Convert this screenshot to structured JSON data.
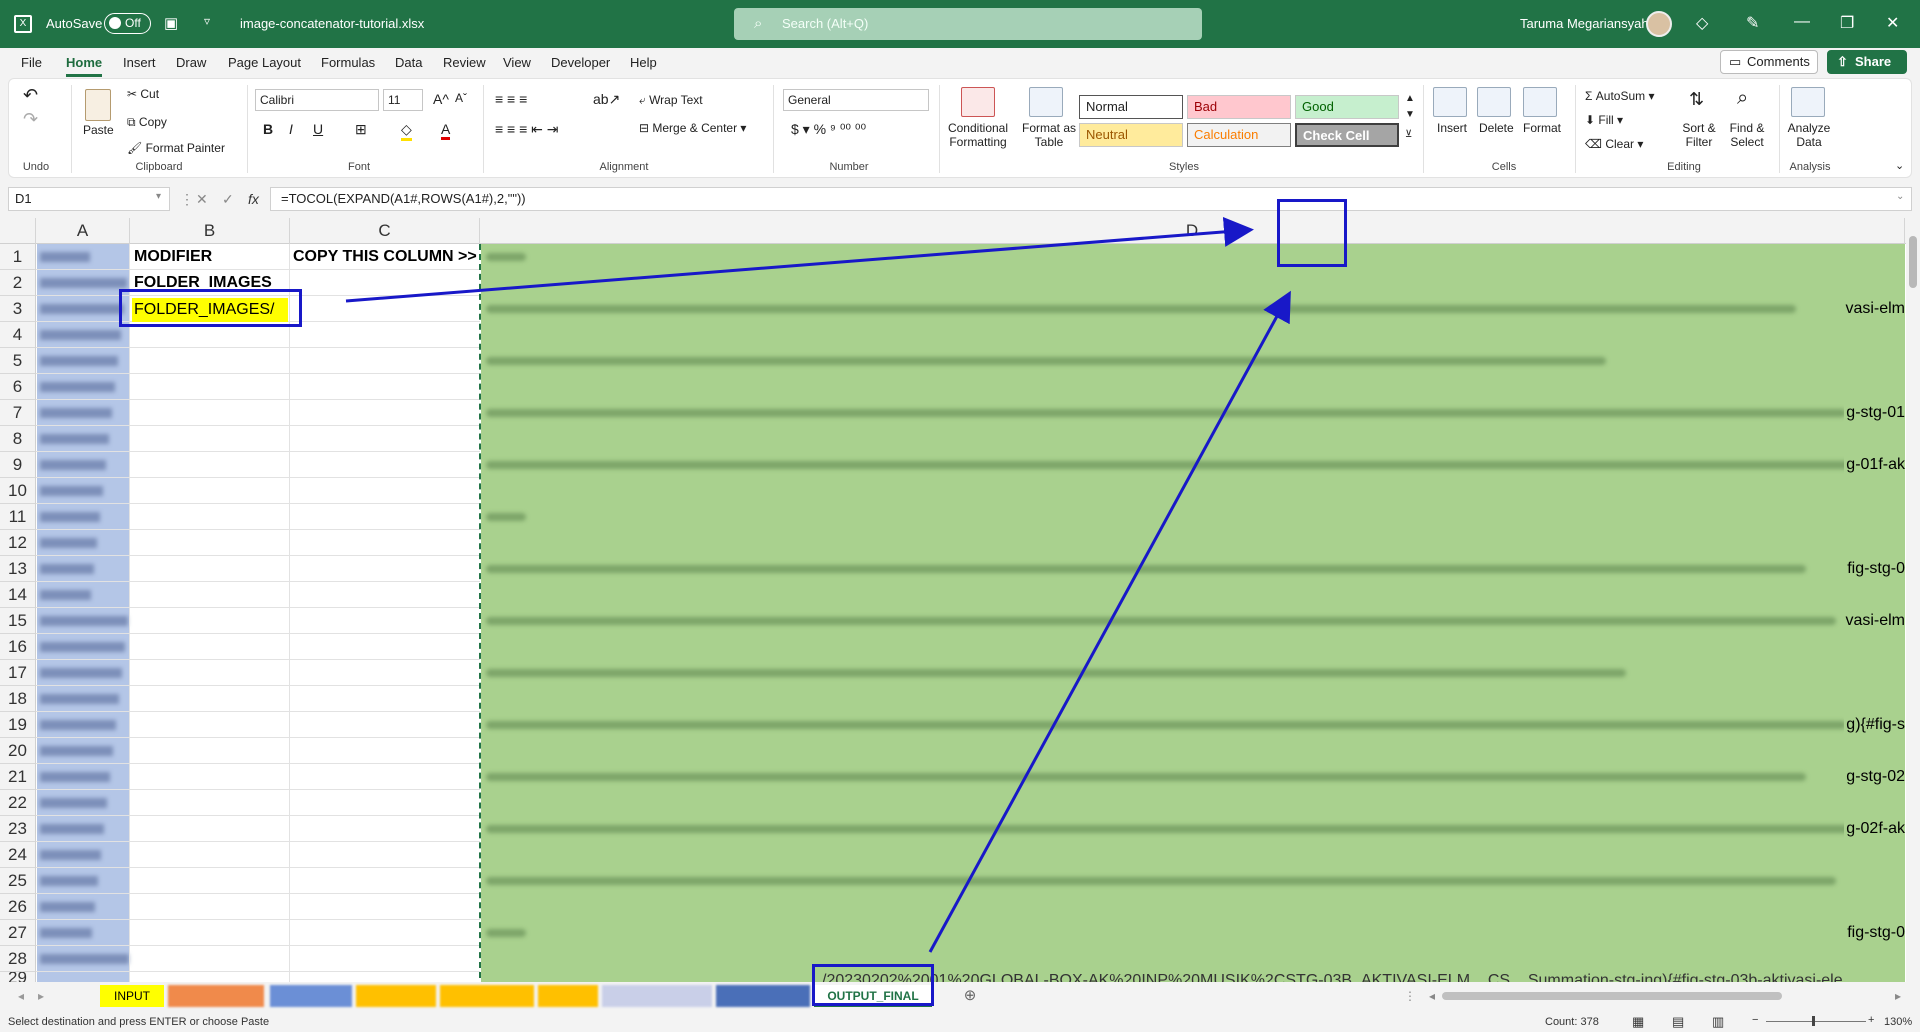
{
  "title_bar": {
    "autosave_label": "AutoSave",
    "autosave_state": "Off",
    "file_name": "image-concatenator-tutorial.xlsx",
    "search_placeholder": "Search (Alt+Q)",
    "user_name": "Taruma Megariansyah"
  },
  "menu": [
    "File",
    "Home",
    "Insert",
    "Draw",
    "Page Layout",
    "Formulas",
    "Data",
    "Review",
    "View",
    "Developer",
    "Help"
  ],
  "menu_active": "Home",
  "top_buttons": {
    "comments": "Comments",
    "share": "Share"
  },
  "ribbon": {
    "undo_group": "Undo",
    "clipboard": {
      "paste": "Paste",
      "cut": "Cut",
      "copy": "Copy",
      "format_painter": "Format Painter",
      "group": "Clipboard"
    },
    "font": {
      "name": "Calibri",
      "size": "11",
      "group": "Font"
    },
    "alignment": {
      "wrap": "Wrap Text",
      "merge": "Merge & Center",
      "group": "Alignment"
    },
    "number": {
      "format": "General",
      "group": "Number"
    },
    "styles": {
      "conditional": "Conditional Formatting",
      "format_table": "Format as Table",
      "normal": "Normal",
      "bad": "Bad",
      "good": "Good",
      "neutral": "Neutral",
      "calculation": "Calculation",
      "check_cell": "Check Cell",
      "group": "Styles"
    },
    "cells": {
      "insert": "Insert",
      "delete": "Delete",
      "format": "Format",
      "group": "Cells"
    },
    "editing": {
      "autosum": "AutoSum",
      "fill": "Fill",
      "clear": "Clear",
      "sort": "Sort & Filter",
      "find": "Find & Select",
      "group": "Editing"
    },
    "analysis": {
      "analyze": "Analyze Data",
      "group": "Analysis"
    }
  },
  "formula_bar": {
    "name_box": "D1",
    "formula": "=TOCOL(EXPAND(A1#,ROWS(A1#),2,\"\"))"
  },
  "columns": [
    "A",
    "B",
    "C",
    "D"
  ],
  "rows": [
    "1",
    "2",
    "3",
    "4",
    "5",
    "6",
    "7",
    "8",
    "9",
    "10",
    "11",
    "12",
    "13",
    "14",
    "15",
    "16",
    "17",
    "18",
    "19",
    "20",
    "21",
    "22",
    "23",
    "24",
    "25",
    "26",
    "27",
    "28"
  ],
  "cells": {
    "b1": "MODIFIER",
    "b2": "FOLDER_IMAGES",
    "b3": "FOLDER_IMAGES/",
    "c1": "COPY THIS COLUMN >>",
    "d_fragments": {
      "r3": "vasi-elm",
      "r7": "g-stg-01",
      "r9": "g-01f-ak",
      "r13": "fig-stg-0",
      "r15": "vasi-elm",
      "r19": "g){#fig-s",
      "r21": "g-stg-02",
      "r23": "g-02f-ak",
      "r27": "fig-stg-0",
      "r29": "/20230202%2001%20GLOBAL-BOX-AK%20INP%20MUSIK%2CSTG-03B_AKTIVASI-ELM__CS__Summation-stg-ing){#fig-stg-03b-aktivasi-ele"
    }
  },
  "sheet_tabs": [
    "INPUT",
    "OUTPUT_FINAL"
  ],
  "status": {
    "message": "Select destination and press ENTER or choose Paste",
    "count": "Count: 378",
    "zoom": "130%"
  }
}
